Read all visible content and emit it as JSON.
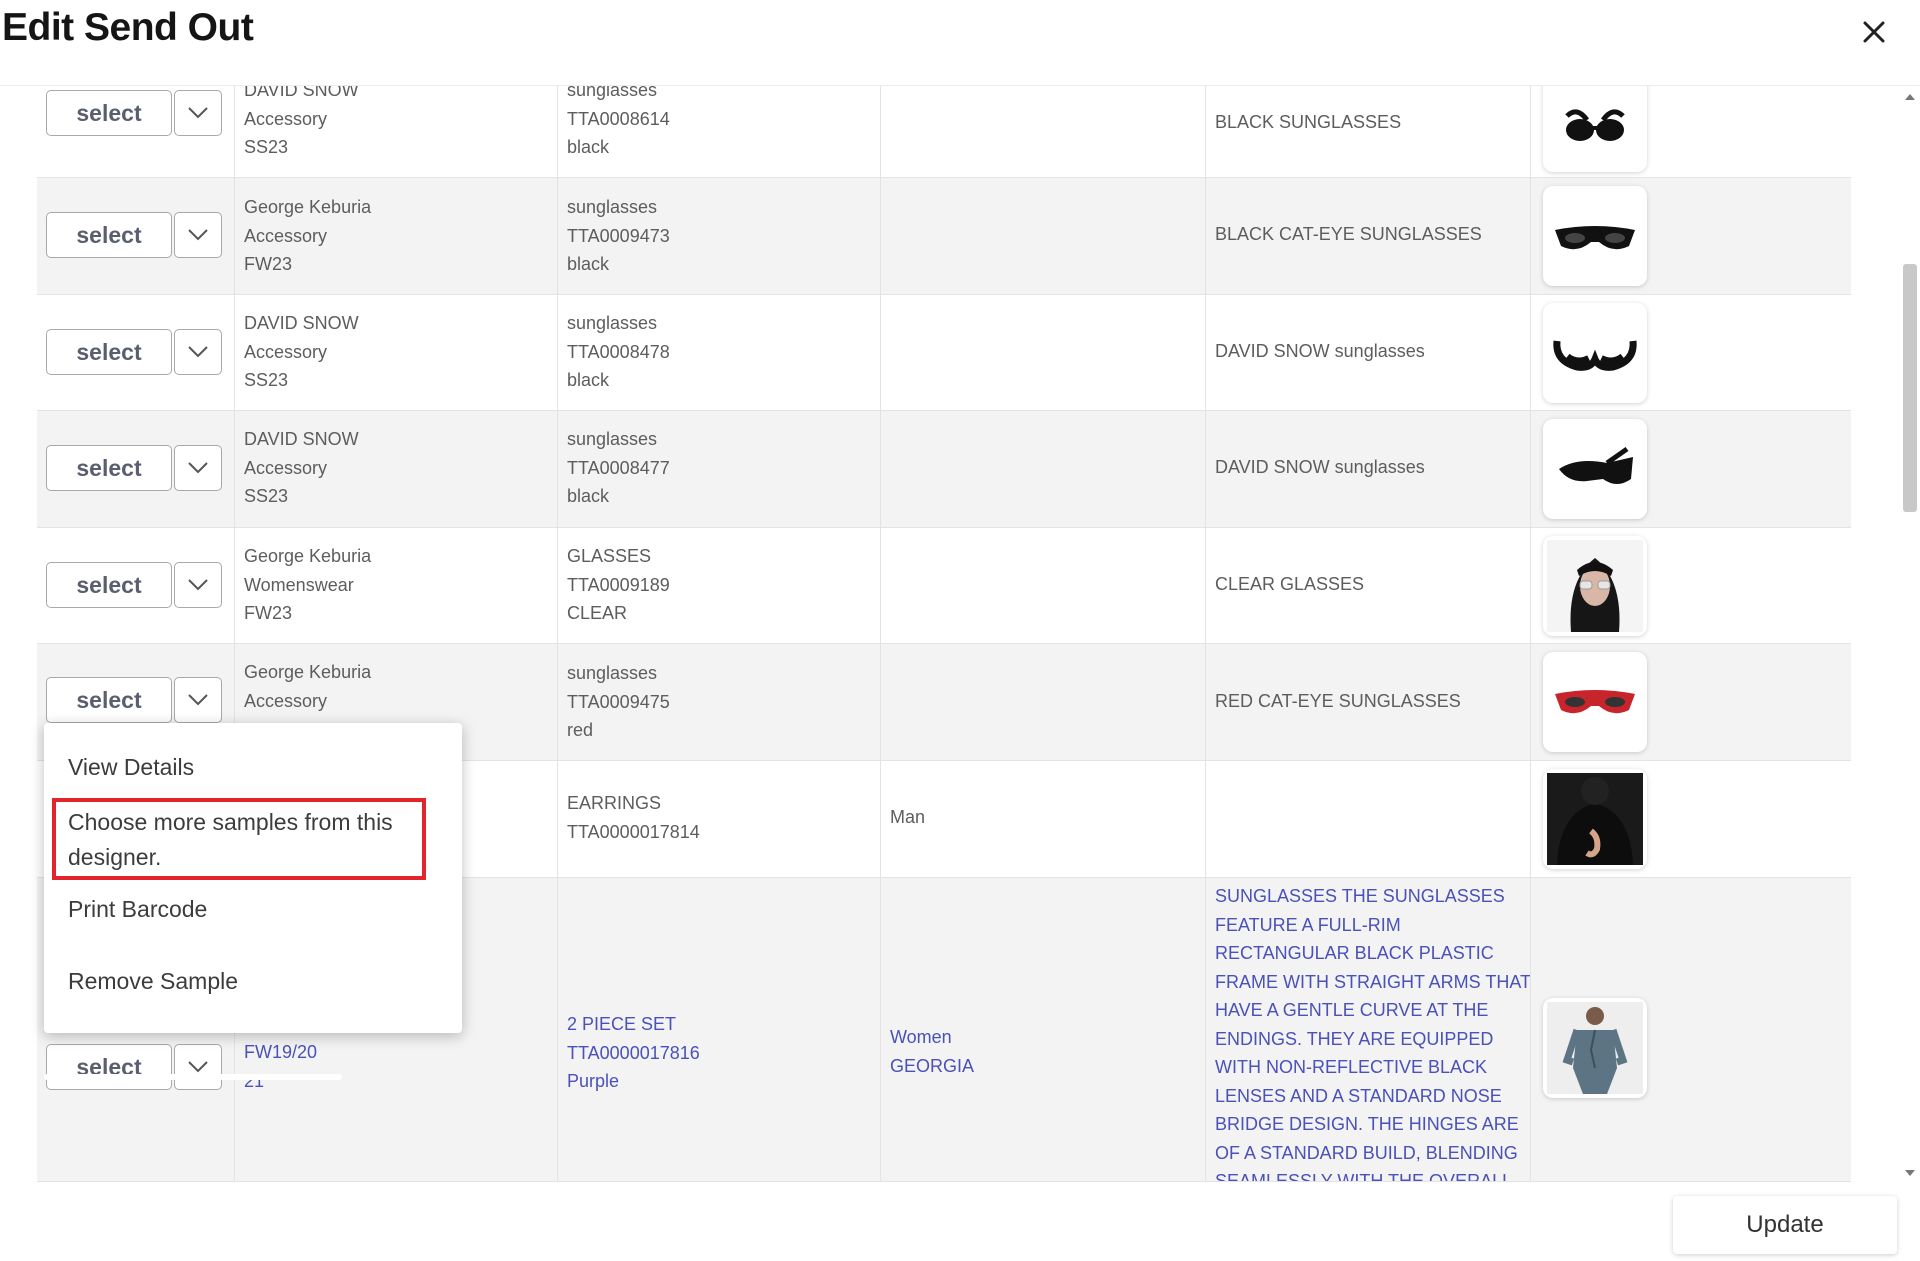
{
  "dialog": {
    "title": "Edit Send Out",
    "close_icon": "close-icon"
  },
  "select_label": "select",
  "rows": [
    {
      "designer": "DAVID SNOW",
      "category": "Accessory",
      "season": "SS23",
      "type": "sunglasses",
      "sku": "TTA0008614",
      "color": "black",
      "gender": "",
      "description": "BLACK SUNGLASSES",
      "image": "sunglasses-black-round"
    },
    {
      "designer": "George Keburia",
      "category": "Accessory",
      "season": "FW23",
      "type": "sunglasses",
      "sku": "TTA0009473",
      "color": "black",
      "gender": "",
      "description": "BLACK CAT-EYE SUNGLASSES",
      "image": "sunglasses-black-cateye"
    },
    {
      "designer": "DAVID SNOW",
      "category": "Accessory",
      "season": "SS23",
      "type": "sunglasses",
      "sku": "TTA0008478",
      "color": "black",
      "gender": "",
      "description": "DAVID SNOW sunglasses",
      "image": "sunglasses-black-wrap"
    },
    {
      "designer": "DAVID SNOW",
      "category": "Accessory",
      "season": "SS23",
      "type": "sunglasses",
      "sku": "TTA0008477",
      "color": "black",
      "gender": "",
      "description": "DAVID SNOW sunglasses",
      "image": "sunglasses-black-side"
    },
    {
      "designer": "George Keburia",
      "category": "Womenswear",
      "season": "FW23",
      "type": "GLASSES",
      "sku": "TTA0009189",
      "color": "CLEAR",
      "gender": "",
      "description": "CLEAR GLASSES",
      "image": "model-clear-glasses"
    },
    {
      "designer": "George Keburia",
      "category": "Accessory",
      "season": "",
      "type": "sunglasses",
      "sku": "TTA0009475",
      "color": "red",
      "gender": "",
      "description": "RED CAT-EYE SUNGLASSES",
      "image": "sunglasses-red-cateye"
    },
    {
      "designer": "",
      "category": "",
      "season": "",
      "type": "EARRINGS",
      "sku": "TTA0000017814",
      "color": "",
      "gender": "Man",
      "description": "",
      "image": "earrings-model"
    },
    {
      "designer": "",
      "category": "",
      "season": "FW19/20",
      "extra": "21",
      "type": "2 PIECE SET",
      "sku": "TTA0000017816",
      "color": "Purple",
      "gender": "Women",
      "region": "GEORGIA",
      "description": "SUNGLASSES THE SUNGLASSES FEATURE A FULL-RIM RECTANGULAR BLACK PLASTIC FRAME WITH STRAIGHT ARMS THAT HAVE A GENTLE CURVE AT THE ENDINGS. THEY ARE EQUIPPED WITH NON-REFLECTIVE BLACK LENSES AND A STANDARD NOSE BRIDGE DESIGN. THE HINGES ARE OF A STANDARD BUILD, BLENDING SEAMLESSLY WITH THE OVERALL SILHOUETTE OF",
      "image": "model-blue-suit"
    }
  ],
  "context_menu": {
    "items": [
      "View Details",
      "Choose more samples from this designer.",
      "Print Barcode",
      "Remove Sample"
    ],
    "highlighted_index": 1,
    "highlight_color": "#e3242b"
  },
  "footer": {
    "update_label": "Update"
  },
  "colors": {
    "link_text": "#4a51b8",
    "row_alt": "#f3f3f3"
  }
}
